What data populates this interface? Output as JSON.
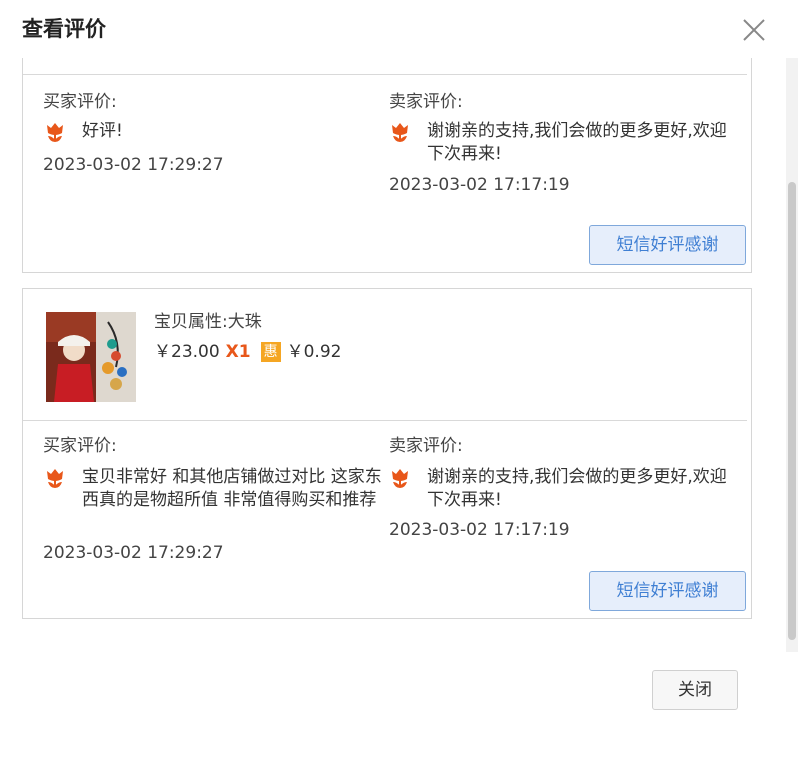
{
  "dialog": {
    "title": "查看评价",
    "close_label": "关闭"
  },
  "reviews": [
    {
      "buyer_label": "买家评价:",
      "buyer_text": "好评!",
      "buyer_time": "2023-03-02 17:29:27",
      "seller_label": "卖家评价:",
      "seller_text": "谢谢亲的支持,我们会做的更多更好,欢迎下次再来!",
      "seller_time": "2023-03-02 17:17:19",
      "thanks_button": "短信好评感谢"
    },
    {
      "product": {
        "property": "宝贝属性:大珠",
        "price": "￥23.00",
        "quantity": "X1",
        "discount_badge": "惠",
        "discount": "￥0.92"
      },
      "buyer_label": "买家评价:",
      "buyer_text": "宝贝非常好 和其他店铺做过对比 这家东西真的是物超所值 非常值得购买和推荐",
      "buyer_time": "2023-03-02 17:29:27",
      "seller_label": "卖家评价:",
      "seller_text": "谢谢亲的支持,我们会做的更多更好,欢迎下次再来!",
      "seller_time": "2023-03-02 17:17:19",
      "thanks_button": "短信好评感谢"
    }
  ],
  "colors": {
    "accent_blue": "#3f7fd3",
    "flower_icon": "#e8571a",
    "quantity": "#e8571a",
    "discount_badge": "#f5a623"
  },
  "icons": [
    "close-icon",
    "tulip-icon",
    "product-thumbnail"
  ]
}
